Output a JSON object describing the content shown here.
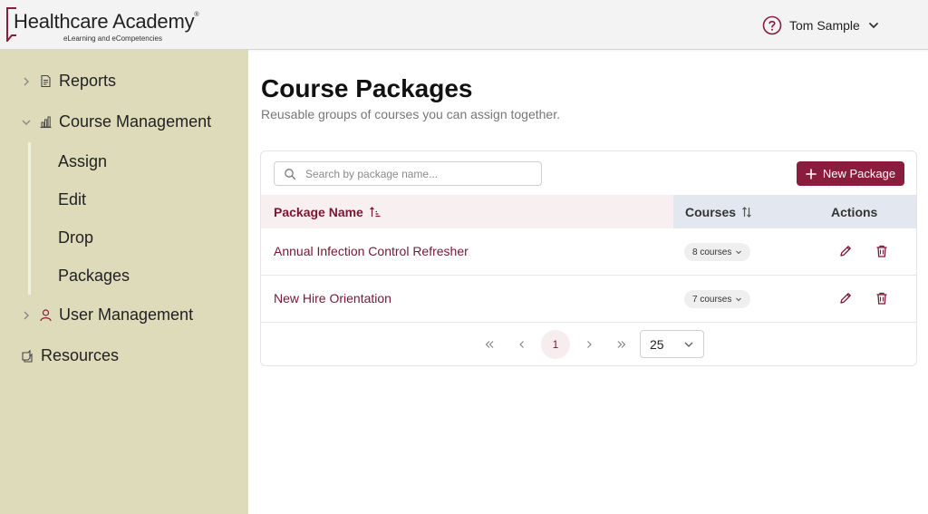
{
  "header": {
    "logo_title": "Healthcare Academy",
    "logo_mark": "®",
    "logo_tagline": "eLearning and eCompetencies",
    "user_name": "Tom Sample"
  },
  "sidebar": {
    "items": [
      {
        "label": "Reports",
        "icon": "document-icon"
      },
      {
        "label": "Course Management",
        "icon": "chart-icon"
      },
      {
        "label": "User Management",
        "icon": "user-icon"
      },
      {
        "label": "Resources",
        "icon": "books-icon"
      }
    ],
    "sub_items": [
      "Assign",
      "Edit",
      "Drop",
      "Packages"
    ]
  },
  "main": {
    "title": "Course Packages",
    "subtitle": "Reusable groups of courses you can assign together.",
    "search_placeholder": "Search by package name...",
    "new_button": "New Package",
    "columns": {
      "name": "Package Name",
      "courses": "Courses",
      "actions": "Actions"
    },
    "rows": [
      {
        "name": "Annual Infection Control Refresher",
        "courses": "8 courses"
      },
      {
        "name": "New Hire Orientation",
        "courses": "7 courses"
      }
    ],
    "pagination": {
      "current_page": "1",
      "page_size": "25"
    }
  },
  "colors": {
    "brand": "#8a1c3e",
    "sidebar_bg": "#dedbbb",
    "link": "#7a1634"
  }
}
